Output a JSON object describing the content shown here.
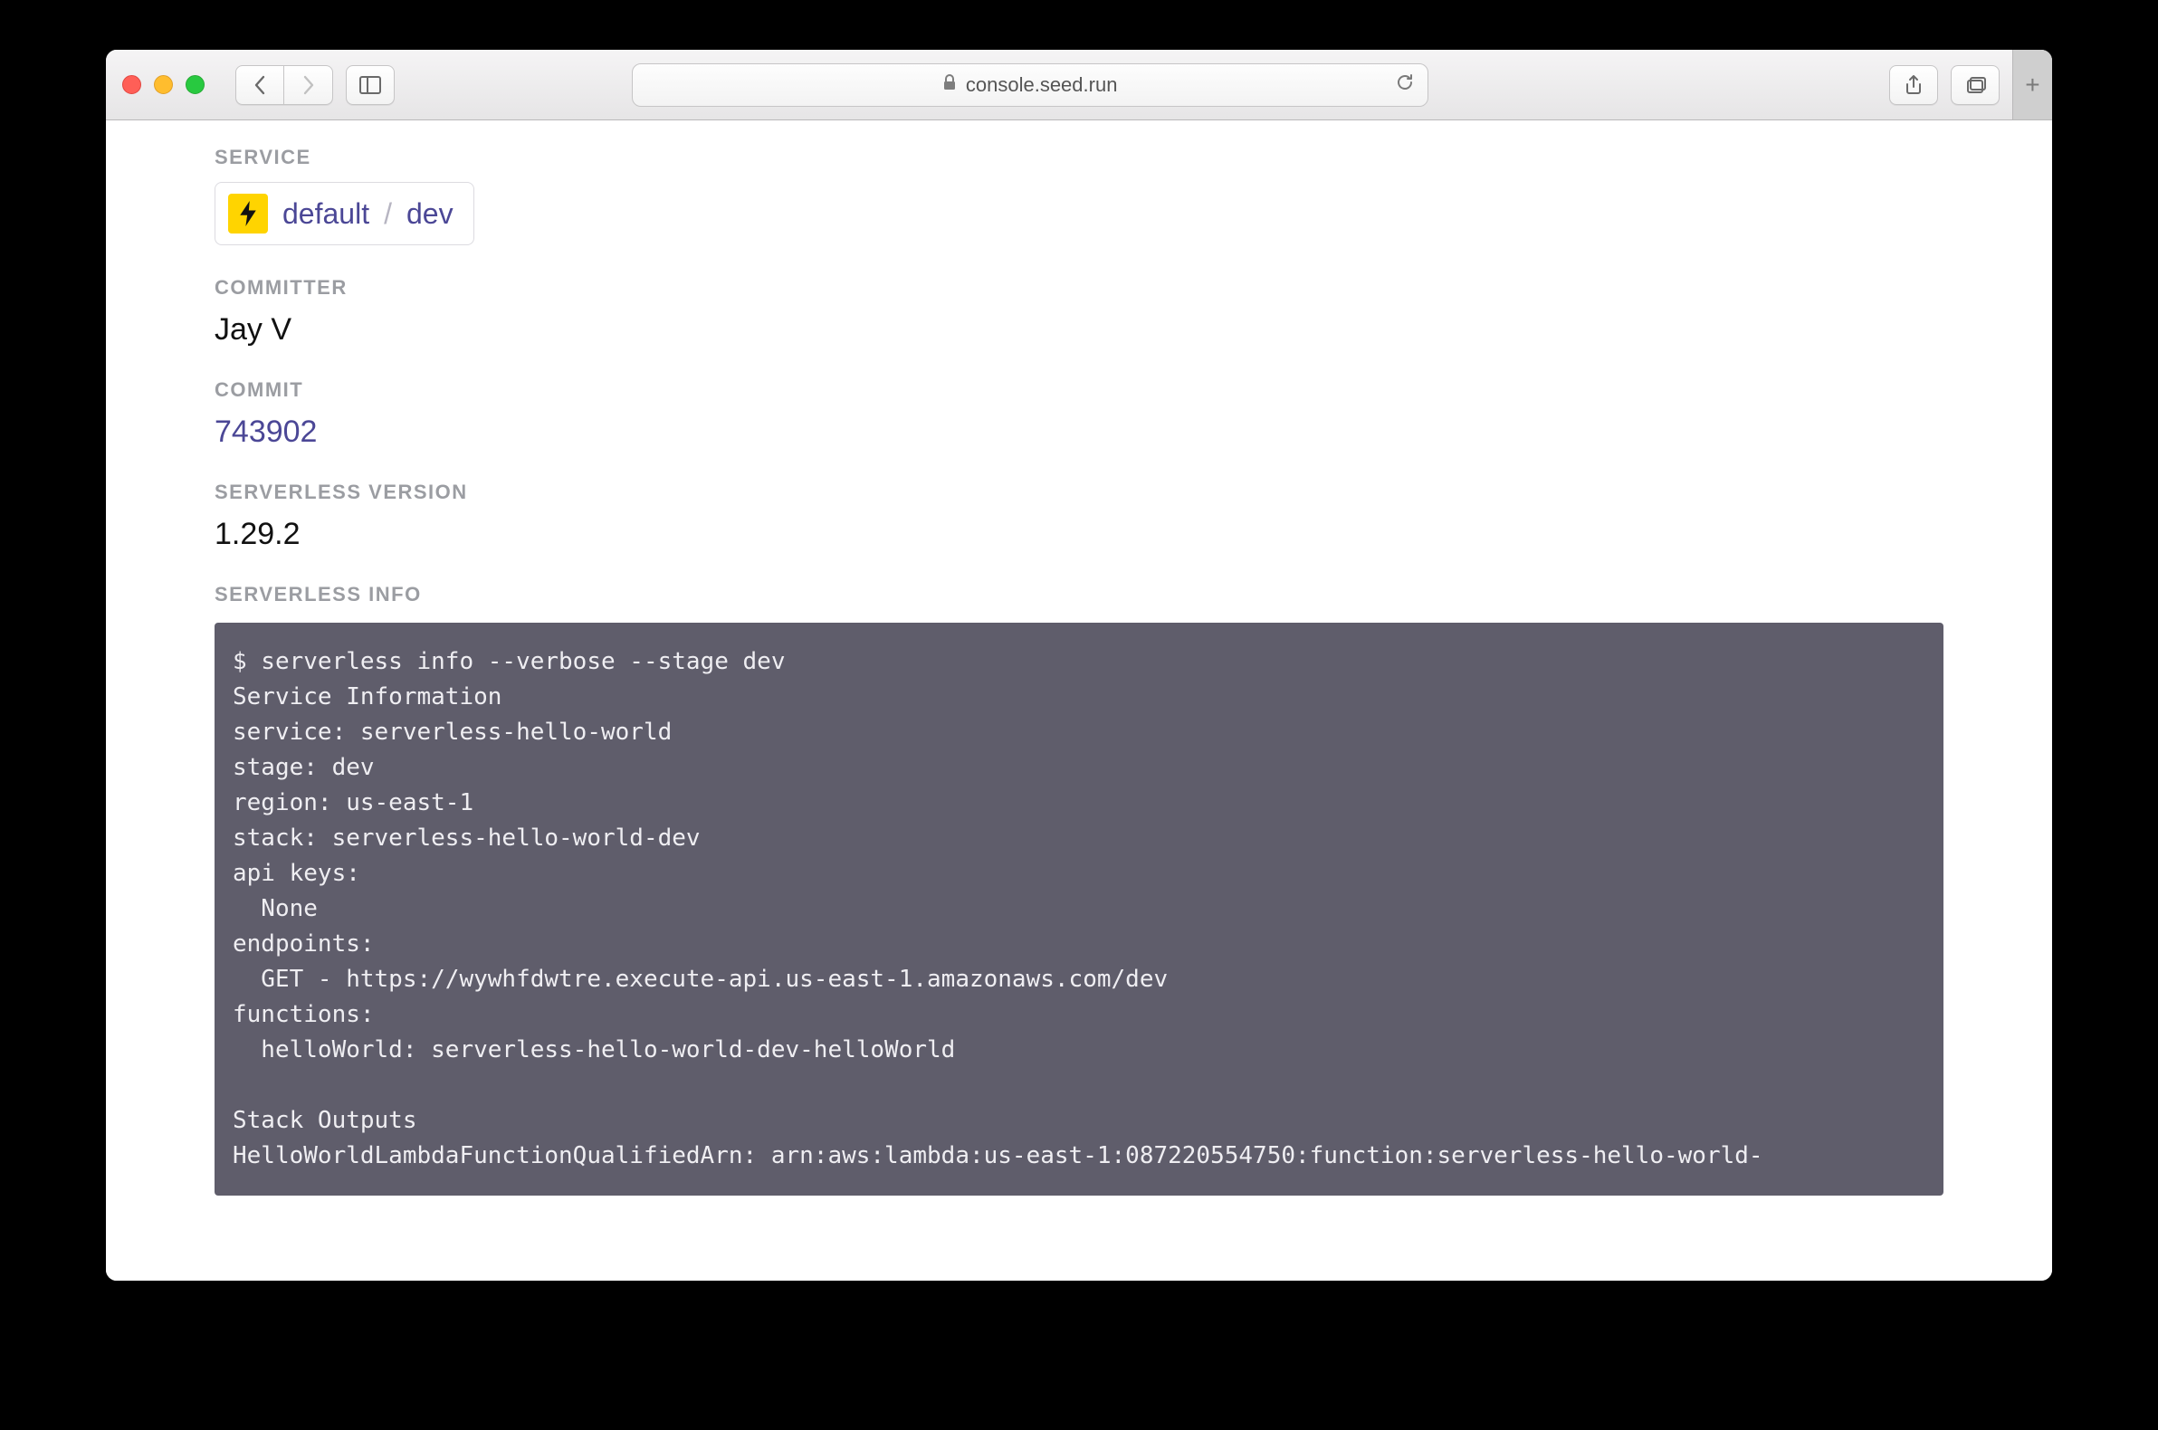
{
  "browser": {
    "url_display": "console.seed.run"
  },
  "labels": {
    "service": "SERVICE",
    "committer": "COMMITTER",
    "commit": "COMMIT",
    "serverless_version": "SERVERLESS VERSION",
    "serverless_info": "SERVERLESS INFO"
  },
  "service": {
    "name": "default",
    "stage": "dev",
    "separator": "/"
  },
  "committer": "Jay V",
  "commit": "743902",
  "serverless_version": "1.29.2",
  "serverless_info_text": "$ serverless info --verbose --stage dev\nService Information\nservice: serverless-hello-world\nstage: dev\nregion: us-east-1\nstack: serverless-hello-world-dev\napi keys:\n  None\nendpoints:\n  GET - https://wywhfdwtre.execute-api.us-east-1.amazonaws.com/dev\nfunctions:\n  helloWorld: serverless-hello-world-dev-helloWorld\n\nStack Outputs\nHelloWorldLambdaFunctionQualifiedArn: arn:aws:lambda:us-east-1:087220554750:function:serverless-hello-world-"
}
